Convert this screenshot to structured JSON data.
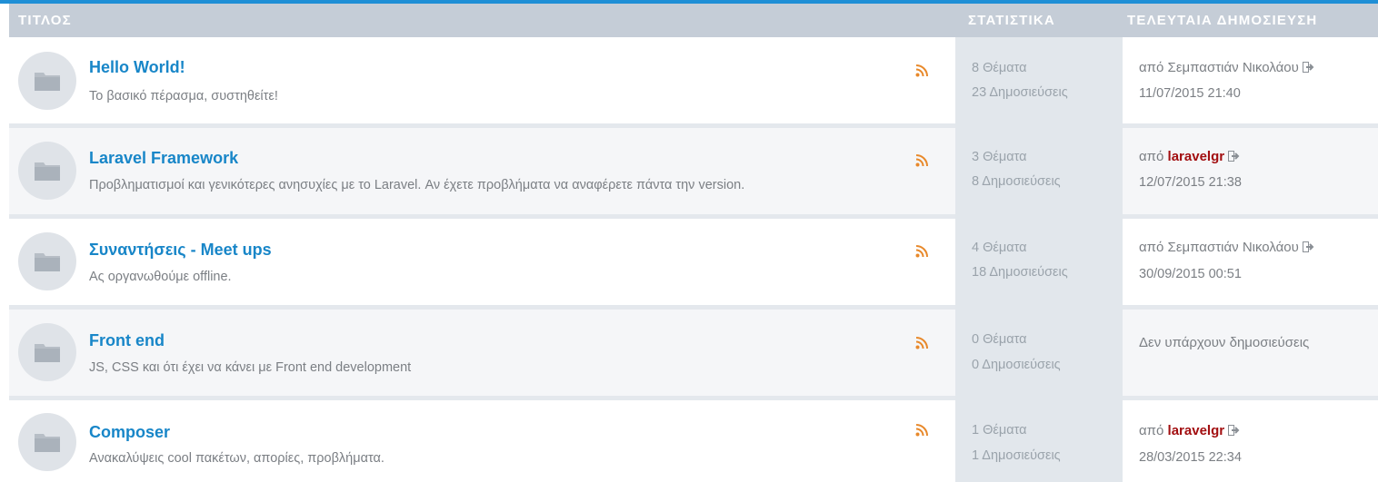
{
  "header": {
    "title_col": "ΤΙΤΛΟΣ",
    "stats_col": "ΣΤΑΤΙΣΤΙΚΑ",
    "last_col": "ΤΕΛΕΥΤΑΙΑ ΔΗΜΟΣΙΕΥΣΗ"
  },
  "colors": {
    "accent": "#1f8fd6",
    "header_bg": "#c5cdd7",
    "title_link": "#1886c8",
    "rss": "#e8892b",
    "admin_user": "#a20e10"
  },
  "icons": {
    "avatar": "folder-icon",
    "feed": "rss-icon",
    "jump": "sign-in-arrow-icon"
  },
  "forums": [
    {
      "title": "Hello World!",
      "description": "Το βασικό πέρασμα, συστηθείτε!",
      "topics": "8 Θέματα",
      "posts": "23 Δημοσιεύσεις",
      "last": {
        "prefix": "από",
        "user": "Σεμπαστιάν Νικολάου",
        "admin": false,
        "date": "11/07/2015 21:40"
      }
    },
    {
      "title": "Laravel Framework",
      "description": "Προβληματισμοί και γενικότερες ανησυχίες με το Laravel. Αν έχετε προβλήματα να αναφέρετε πάντα την version.",
      "topics": "3 Θέματα",
      "posts": "8 Δημοσιεύσεις",
      "last": {
        "prefix": "από",
        "user": "laravelgr",
        "admin": true,
        "date": "12/07/2015 21:38"
      }
    },
    {
      "title": "Συναντήσεις - Meet ups",
      "description": "Ας οργανωθούμε offline.",
      "topics": "4 Θέματα",
      "posts": "18 Δημοσιεύσεις",
      "last": {
        "prefix": "από",
        "user": "Σεμπαστιάν Νικολάου",
        "admin": false,
        "date": "30/09/2015 00:51"
      }
    },
    {
      "title": "Front end",
      "description": "JS, CSS και ότι έχει να κάνει με Front end development",
      "topics": "0 Θέματα",
      "posts": "0 Δημοσιεύσεις",
      "no_posts": "Δεν υπάρχουν δημοσιεύσεις"
    },
    {
      "title": "Composer",
      "description": "Ανακαλύψεις cool πακέτων, απορίες, προβλήματα.",
      "topics": "1 Θέματα",
      "posts": "1 Δημοσιεύσεις",
      "last": {
        "prefix": "από",
        "user": "laravelgr",
        "admin": true,
        "date": "28/03/2015 22:34"
      }
    }
  ]
}
